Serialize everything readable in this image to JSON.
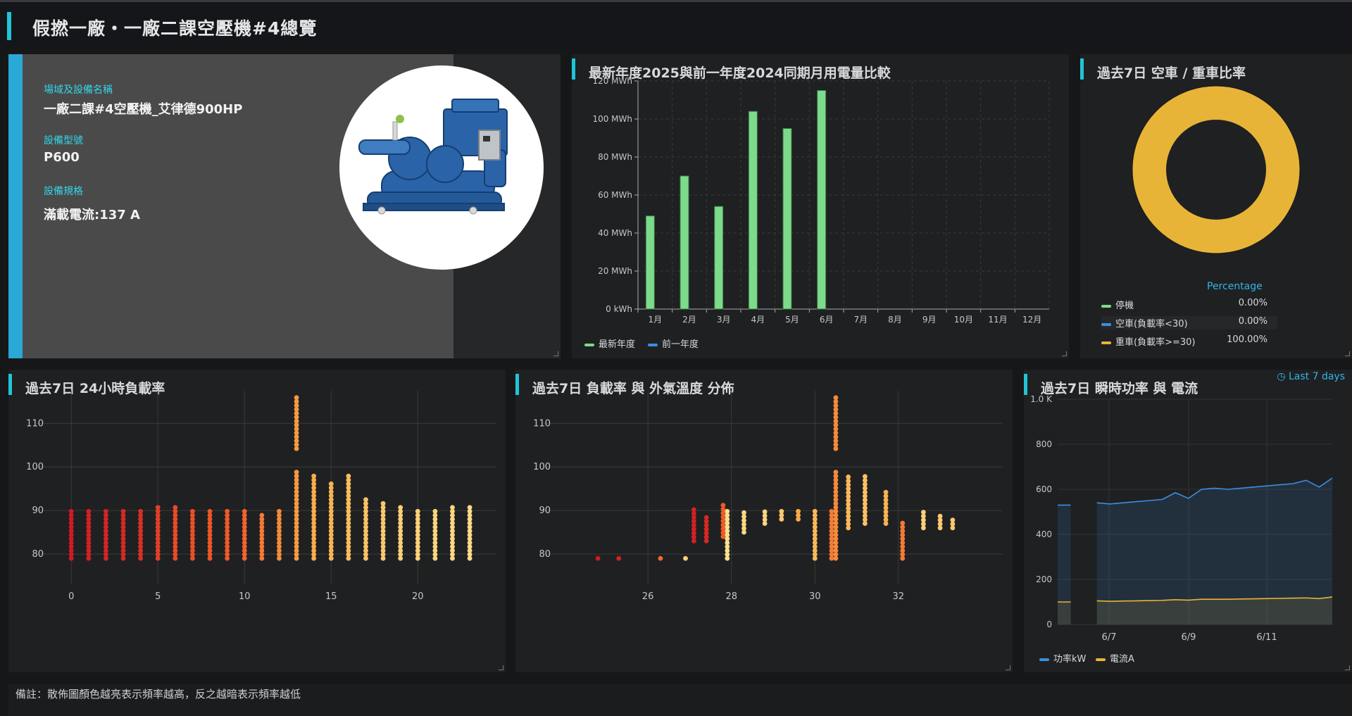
{
  "header": {
    "title": "假撚一廠・一廠二課空壓機#4總覽"
  },
  "info": {
    "site_label": "場域及設備名稱",
    "site_value": "一廠二課#4空壓機_艾律德900HP",
    "model_label": "設備型號",
    "model_value": "P600",
    "spec_label": "設備規格",
    "spec_value": "滿載電流:137 A"
  },
  "monthly_panel": {
    "title": "最新年度2025與前一年度2024同期月用電量比較"
  },
  "ratio_panel": {
    "title": "過去7日 空車 / 重車比率"
  },
  "load_panel": {
    "title": "過去7日 24小時負載率"
  },
  "temp_panel": {
    "title": "過去7日 負載率 與 外氣溫度 分佈"
  },
  "power_panel": {
    "title": "過去7日 瞬時功率 與 電流",
    "time_range": "Last 7 days"
  },
  "note": "備註：散佈圖顏色越亮表示頻率越高，反之越暗表示頻率越低",
  "chart_data": [
    {
      "type": "bar",
      "categories": [
        "1月",
        "2月",
        "3月",
        "4月",
        "5月",
        "6月",
        "7月",
        "8月",
        "9月",
        "10月",
        "11月",
        "12月"
      ],
      "series": [
        {
          "name": "最新年度",
          "color": "#7eda8b",
          "values": [
            49,
            70,
            54,
            104,
            95,
            115,
            null,
            null,
            null,
            null,
            null,
            null
          ]
        },
        {
          "name": "前一年度",
          "color": "#3b8ee0",
          "values": [
            null,
            null,
            null,
            null,
            null,
            null,
            null,
            null,
            null,
            null,
            null,
            null
          ]
        }
      ],
      "yticks": [
        "0 kWh",
        "20 MWh",
        "40 MWh",
        "60 MWh",
        "80 MWh",
        "100 MWh",
        "120 MWh"
      ],
      "ylim": [
        0,
        120
      ]
    },
    {
      "type": "pie",
      "legend_header": "Percentage",
      "slices": [
        {
          "name": "停機",
          "value": "0.00%",
          "pct": 0,
          "color": "#7eda8b"
        },
        {
          "name": "空車(負載率<30)",
          "value": "0.00%",
          "pct": 0,
          "color": "#3b8ee0"
        },
        {
          "name": "重車(負載率>=30)",
          "value": "100.00%",
          "pct": 100,
          "color": "#e8b437"
        }
      ]
    },
    {
      "type": "scatter",
      "name": "load-by-hour",
      "xlim": [
        -2,
        24.5
      ],
      "ylim": [
        74.5,
        117
      ],
      "xticks": [
        0,
        5,
        10,
        15,
        20
      ],
      "yticks": [
        80,
        90,
        100,
        110
      ],
      "columns": [
        {
          "x": 0,
          "ymin": 79,
          "ymax": 90,
          "heat": 0.05
        },
        {
          "x": 1,
          "ymin": 79,
          "ymax": 90,
          "heat": 0.08
        },
        {
          "x": 2,
          "ymin": 79,
          "ymax": 90,
          "heat": 0.1
        },
        {
          "x": 3,
          "ymin": 79,
          "ymax": 90,
          "heat": 0.12
        },
        {
          "x": 4,
          "ymin": 79,
          "ymax": 90,
          "heat": 0.15
        },
        {
          "x": 5,
          "ymin": 79,
          "ymax": 91,
          "heat": 0.22
        },
        {
          "x": 6,
          "ymin": 79,
          "ymax": 91,
          "heat": 0.28
        },
        {
          "x": 7,
          "ymin": 79,
          "ymax": 90,
          "heat": 0.3
        },
        {
          "x": 8,
          "ymin": 79,
          "ymax": 90,
          "heat": 0.33
        },
        {
          "x": 9,
          "ymin": 79,
          "ymax": 90,
          "heat": 0.35
        },
        {
          "x": 10,
          "ymin": 79,
          "ymax": 90,
          "heat": 0.38
        },
        {
          "x": 11,
          "ymin": 79,
          "ymax": 89,
          "heat": 0.45
        },
        {
          "x": 12,
          "ymin": 79,
          "ymax": 90,
          "heat": 0.5
        },
        {
          "x": 13,
          "ymin": 79,
          "ymax": 116,
          "heat": 0.55
        },
        {
          "x": 14,
          "ymin": 79,
          "ymax": 98,
          "heat": 0.62
        },
        {
          "x": 15,
          "ymin": 79,
          "ymax": 97,
          "heat": 0.66
        },
        {
          "x": 16,
          "ymin": 79,
          "ymax": 98,
          "heat": 0.72
        },
        {
          "x": 17,
          "ymin": 79,
          "ymax": 93,
          "heat": 0.76
        },
        {
          "x": 18,
          "ymin": 79,
          "ymax": 92,
          "heat": 0.8
        },
        {
          "x": 19,
          "ymin": 79,
          "ymax": 91,
          "heat": 0.84
        },
        {
          "x": 20,
          "ymin": 79,
          "ymax": 90,
          "heat": 0.86
        },
        {
          "x": 21,
          "ymin": 79,
          "ymax": 90,
          "heat": 0.88
        },
        {
          "x": 22,
          "ymin": 79,
          "ymax": 91,
          "heat": 0.9
        },
        {
          "x": 23,
          "ymin": 79,
          "ymax": 91,
          "heat": 0.92
        }
      ]
    },
    {
      "type": "scatter",
      "name": "load-vs-temp",
      "xlim": [
        23.5,
        34.5
      ],
      "ylim": [
        74.5,
        117
      ],
      "xticks": [
        26,
        28,
        30,
        32
      ],
      "yticks": [
        80,
        90,
        100,
        110
      ],
      "clusters": [
        {
          "x": 24.8,
          "ymin": 79,
          "ymax": 79.5,
          "heat": 0.05
        },
        {
          "x": 25.3,
          "ymin": 79,
          "ymax": 79.5,
          "heat": 0.08
        },
        {
          "x": 26.3,
          "ymin": 79,
          "ymax": 79.5,
          "heat": 0.4
        },
        {
          "x": 26.9,
          "ymin": 79,
          "ymax": 79.5,
          "heat": 0.85
        },
        {
          "x": 27.1,
          "ymin": 83,
          "ymax": 91,
          "heat": 0.08
        },
        {
          "x": 27.4,
          "ymin": 83,
          "ymax": 89,
          "heat": 0.12
        },
        {
          "x": 27.8,
          "ymin": 84,
          "ymax": 92,
          "heat": 0.35
        },
        {
          "x": 27.9,
          "ymin": 79,
          "ymax": 90,
          "heat": 0.95
        },
        {
          "x": 28.3,
          "ymin": 85,
          "ymax": 90,
          "heat": 0.9
        },
        {
          "x": 28.8,
          "ymin": 87,
          "ymax": 90,
          "heat": 0.88
        },
        {
          "x": 29.2,
          "ymin": 88,
          "ymax": 90,
          "heat": 0.8
        },
        {
          "x": 29.6,
          "ymin": 88,
          "ymax": 90,
          "heat": 0.6
        },
        {
          "x": 30.0,
          "ymin": 79,
          "ymax": 90,
          "heat": 0.7
        },
        {
          "x": 30.4,
          "ymin": 79,
          "ymax": 90,
          "heat": 0.45
        },
        {
          "x": 30.5,
          "ymin": 79,
          "ymax": 116,
          "heat": 0.5
        },
        {
          "x": 30.8,
          "ymin": 86,
          "ymax": 98,
          "heat": 0.7
        },
        {
          "x": 31.2,
          "ymin": 87,
          "ymax": 98,
          "heat": 0.75
        },
        {
          "x": 31.7,
          "ymin": 87,
          "ymax": 95,
          "heat": 0.65
        },
        {
          "x": 32.1,
          "ymin": 79,
          "ymax": 88,
          "heat": 0.45
        },
        {
          "x": 32.6,
          "ymin": 86,
          "ymax": 90,
          "heat": 0.85
        },
        {
          "x": 33.0,
          "ymin": 86,
          "ymax": 89,
          "heat": 0.82
        },
        {
          "x": 33.3,
          "ymin": 86,
          "ymax": 88,
          "heat": 0.8
        }
      ]
    },
    {
      "type": "area",
      "xticks": [
        "6/7",
        "6/9",
        "6/11"
      ],
      "yticks": [
        "0",
        "200",
        "400",
        "600",
        "800",
        "1.0 K"
      ],
      "ylim": [
        0,
        1000
      ],
      "series": [
        {
          "name": "功率kW",
          "color": "#3b8ee0",
          "values": [
            530,
            530,
            0,
            540,
            535,
            540,
            545,
            550,
            555,
            585,
            560,
            600,
            605,
            600,
            605,
            610,
            615,
            620,
            625,
            640,
            610,
            650
          ]
        },
        {
          "name": "電流A",
          "color": "#e8b437",
          "values": [
            100,
            100,
            0,
            105,
            103,
            104,
            105,
            106,
            107,
            110,
            108,
            112,
            112,
            112,
            113,
            114,
            115,
            116,
            117,
            118,
            115,
            122
          ]
        }
      ]
    }
  ]
}
